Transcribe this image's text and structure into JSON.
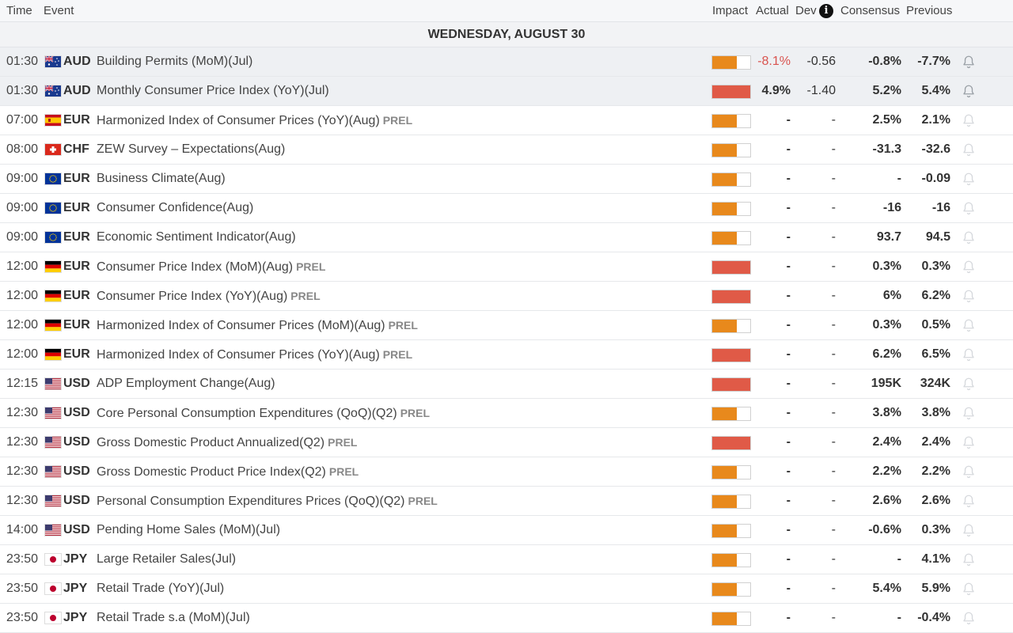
{
  "header": {
    "time": "Time",
    "event": "Event",
    "impact": "Impact",
    "actual": "Actual",
    "dev": "Dev",
    "info_icon": "i",
    "consensus": "Consensus",
    "previous": "Previous"
  },
  "day": "WEDNESDAY, AUGUST 30",
  "colors": {
    "impact_high": "#e05a47",
    "impact_medium": "#e8891c",
    "actual_negative": "#d9534f",
    "bell_active": "#9aa0a6",
    "bell_inactive": "#d6d9dd"
  },
  "rows": [
    {
      "time": "01:30",
      "flag": "au-flag-icon",
      "currency": "AUD",
      "event": "Building Permits (MoM)(Jul)",
      "prel": "",
      "impact": "medium",
      "actual": "-8.1%",
      "actual_negative": true,
      "dev": "-0.56",
      "consensus": "-0.8%",
      "previous": "-7.7%",
      "past": true
    },
    {
      "time": "01:30",
      "flag": "au-flag-icon",
      "currency": "AUD",
      "event": "Monthly Consumer Price Index (YoY)(Jul)",
      "prel": "",
      "impact": "high",
      "actual": "4.9%",
      "actual_negative": false,
      "dev": "-1.40",
      "consensus": "5.2%",
      "previous": "5.4%",
      "past": true
    },
    {
      "time": "07:00",
      "flag": "es-flag-icon",
      "currency": "EUR",
      "event": "Harmonized Index of Consumer Prices (YoY)(Aug)",
      "prel": "PREL",
      "impact": "medium",
      "actual": "-",
      "dev": "-",
      "consensus": "2.5%",
      "previous": "2.1%"
    },
    {
      "time": "08:00",
      "flag": "ch-flag-icon",
      "currency": "CHF",
      "event": "ZEW Survey – Expectations(Aug)",
      "prel": "",
      "impact": "medium",
      "actual": "-",
      "dev": "-",
      "consensus": "-31.3",
      "previous": "-32.6"
    },
    {
      "time": "09:00",
      "flag": "eu-flag-icon",
      "currency": "EUR",
      "event": "Business Climate(Aug)",
      "prel": "",
      "impact": "medium",
      "actual": "-",
      "dev": "-",
      "consensus": "-",
      "previous": "-0.09"
    },
    {
      "time": "09:00",
      "flag": "eu-flag-icon",
      "currency": "EUR",
      "event": "Consumer Confidence(Aug)",
      "prel": "",
      "impact": "medium",
      "actual": "-",
      "dev": "-",
      "consensus": "-16",
      "previous": "-16"
    },
    {
      "time": "09:00",
      "flag": "eu-flag-icon",
      "currency": "EUR",
      "event": "Economic Sentiment Indicator(Aug)",
      "prel": "",
      "impact": "medium",
      "actual": "-",
      "dev": "-",
      "consensus": "93.7",
      "previous": "94.5"
    },
    {
      "time": "12:00",
      "flag": "de-flag-icon",
      "currency": "EUR",
      "event": "Consumer Price Index (MoM)(Aug)",
      "prel": "PREL",
      "impact": "high",
      "actual": "-",
      "dev": "-",
      "consensus": "0.3%",
      "previous": "0.3%"
    },
    {
      "time": "12:00",
      "flag": "de-flag-icon",
      "currency": "EUR",
      "event": "Consumer Price Index (YoY)(Aug)",
      "prel": "PREL",
      "impact": "high",
      "actual": "-",
      "dev": "-",
      "consensus": "6%",
      "previous": "6.2%"
    },
    {
      "time": "12:00",
      "flag": "de-flag-icon",
      "currency": "EUR",
      "event": "Harmonized Index of Consumer Prices (MoM)(Aug)",
      "prel": "PREL",
      "impact": "medium",
      "actual": "-",
      "dev": "-",
      "consensus": "0.3%",
      "previous": "0.5%"
    },
    {
      "time": "12:00",
      "flag": "de-flag-icon",
      "currency": "EUR",
      "event": "Harmonized Index of Consumer Prices (YoY)(Aug)",
      "prel": "PREL",
      "impact": "high",
      "actual": "-",
      "dev": "-",
      "consensus": "6.2%",
      "previous": "6.5%"
    },
    {
      "time": "12:15",
      "flag": "us-flag-icon",
      "currency": "USD",
      "event": "ADP Employment Change(Aug)",
      "prel": "",
      "impact": "high",
      "actual": "-",
      "dev": "-",
      "consensus": "195K",
      "previous": "324K"
    },
    {
      "time": "12:30",
      "flag": "us-flag-icon",
      "currency": "USD",
      "event": "Core Personal Consumption Expenditures (QoQ)(Q2)",
      "prel": "PREL",
      "impact": "medium",
      "actual": "-",
      "dev": "-",
      "consensus": "3.8%",
      "previous": "3.8%"
    },
    {
      "time": "12:30",
      "flag": "us-flag-icon",
      "currency": "USD",
      "event": "Gross Domestic Product Annualized(Q2)",
      "prel": "PREL",
      "impact": "high",
      "actual": "-",
      "dev": "-",
      "consensus": "2.4%",
      "previous": "2.4%"
    },
    {
      "time": "12:30",
      "flag": "us-flag-icon",
      "currency": "USD",
      "event": "Gross Domestic Product Price Index(Q2)",
      "prel": "PREL",
      "impact": "medium",
      "actual": "-",
      "dev": "-",
      "consensus": "2.2%",
      "previous": "2.2%"
    },
    {
      "time": "12:30",
      "flag": "us-flag-icon",
      "currency": "USD",
      "event": "Personal Consumption Expenditures Prices (QoQ)(Q2)",
      "prel": "PREL",
      "impact": "medium",
      "actual": "-",
      "dev": "-",
      "consensus": "2.6%",
      "previous": "2.6%"
    },
    {
      "time": "14:00",
      "flag": "us-flag-icon",
      "currency": "USD",
      "event": "Pending Home Sales (MoM)(Jul)",
      "prel": "",
      "impact": "medium",
      "actual": "-",
      "dev": "-",
      "consensus": "-0.6%",
      "previous": "0.3%"
    },
    {
      "time": "23:50",
      "flag": "jp-flag-icon",
      "currency": "JPY",
      "event": "Large Retailer Sales(Jul)",
      "prel": "",
      "impact": "medium",
      "actual": "-",
      "dev": "-",
      "consensus": "-",
      "previous": "4.1%"
    },
    {
      "time": "23:50",
      "flag": "jp-flag-icon",
      "currency": "JPY",
      "event": "Retail Trade (YoY)(Jul)",
      "prel": "",
      "impact": "medium",
      "actual": "-",
      "dev": "-",
      "consensus": "5.4%",
      "previous": "5.9%"
    },
    {
      "time": "23:50",
      "flag": "jp-flag-icon",
      "currency": "JPY",
      "event": "Retail Trade s.a (MoM)(Jul)",
      "prel": "",
      "impact": "medium",
      "actual": "-",
      "dev": "-",
      "consensus": "-",
      "previous": "-0.4%"
    }
  ]
}
